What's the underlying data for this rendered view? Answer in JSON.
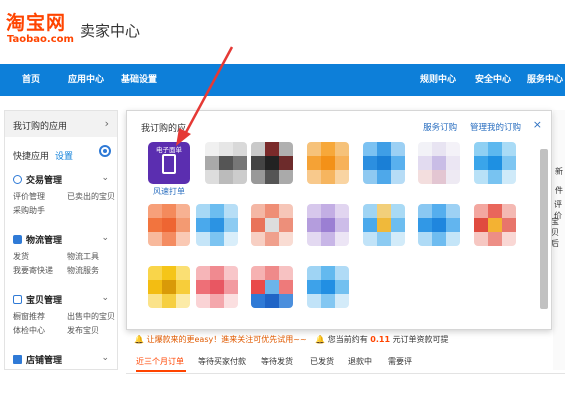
{
  "brand": {
    "logo_cn": "淘宝网",
    "logo_en": "Taobao.com",
    "title": "卖家中心"
  },
  "nav": {
    "items": [
      "首页",
      "应用中心",
      "基础设置",
      "规则中心",
      "安全中心",
      "服务中心"
    ]
  },
  "sidebar": {
    "applied": "我订购的应用",
    "quick_label": "快捷应用",
    "quick_link": "设置",
    "sections": [
      {
        "title": "交易管理",
        "links": [
          "评价管理",
          "已卖出的宝贝",
          "采购助手"
        ]
      },
      {
        "title": "物流管理",
        "links": [
          "发货",
          "物流工具",
          "我要寄快递",
          "物流服务"
        ]
      },
      {
        "title": "宝贝管理",
        "links": [
          "橱窗推荐",
          "出售中的宝贝",
          "体检中心",
          "发布宝贝"
        ]
      },
      {
        "title": "店铺管理",
        "links": []
      }
    ]
  },
  "popup": {
    "title": "我订购的应",
    "links": [
      "服务订购",
      "管理我的订购"
    ],
    "close": "×",
    "first_app": {
      "icon_text": "电子面单",
      "label": "风速打单"
    }
  },
  "right_peek": [
    "新",
    "件",
    "评价",
    "宝贝后"
  ],
  "notice": {
    "left": "让爆款来的更easy！進来关注可优先试用~~",
    "right_prefix": "您当前约有",
    "count": "0.11",
    "right_suffix": "元订单资款可提"
  },
  "orders": {
    "tabs": [
      "近三个月订单",
      "等待买家付款",
      "等待发货",
      "已发货",
      "退款中",
      "需要评"
    ]
  },
  "colors": {
    "brand": "#ff4400",
    "nav": "#0d7fd9",
    "link": "#2b6fc0",
    "arrow": "#e53935"
  }
}
